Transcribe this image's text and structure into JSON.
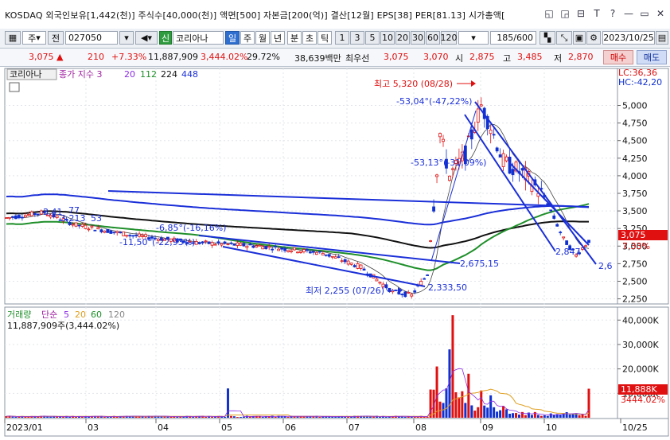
{
  "title_bar": {
    "text": "KOSDAQ 외국인보유[1,442(천)] 주식수[40,000(천)] 액면[500] 자본금[200(억)] 결산[12월] EPS[38] PER[81.13] 시가총액[",
    "buttons": [
      "◱",
      "◲",
      "⊟",
      "T",
      "?",
      "—",
      "▭",
      "✕"
    ]
  },
  "toolbar": {
    "mode_day": "주",
    "mode_all": "전",
    "stock_code": "027050",
    "stock_tag": "신",
    "stock_name": "코리아나",
    "periods": [
      "일",
      "주",
      "월",
      "년",
      "분",
      "초",
      "틱"
    ],
    "active_period": "일",
    "intervals": [
      "1",
      "3",
      "5",
      "10",
      "20",
      "30",
      "60",
      "120"
    ],
    "count": "185",
    "max_count": "/600",
    "date": "2023/10/25"
  },
  "quote": {
    "price": "3,075",
    "arrow": "▲",
    "change": "210",
    "change_pct": "+7.33%",
    "volume": "11,887,909",
    "volume_pct": "3,444.02%",
    "turnover": "29.72%",
    "amount": "38,639백만",
    "priority_label": "최우선",
    "ask": "3,075",
    "bid": "3,070",
    "open_label": "시",
    "open": "2,875",
    "high_label": "고",
    "high": "3,485",
    "low_label": "저",
    "low": "2,870",
    "buy": "매수",
    "sell": "매도"
  },
  "price_panel": {
    "stock_label": "코리아나",
    "indicator_label": "종가 지수 3",
    "ma_values": [
      "20",
      "112",
      "224",
      "448"
    ],
    "lc": "LC:36,36",
    "hc": "HC:-42,20",
    "y_ticks": [
      "5,000",
      "4,750",
      "4,500",
      "4,250",
      "4,000",
      "3,750",
      "3,500",
      "3,250",
      "3,000",
      "2,750",
      "2,500",
      "2,250"
    ],
    "current_price": "3,075",
    "current_pct": "7.33%",
    "annotations": {
      "high": "최고 5,320 (08/28)",
      "low": "최저 2,255 (07/26)",
      "t1": "-53,04°(-47,22%)",
      "t2": "-53,13°(-31,09%)",
      "t3": "-6,85°(-16,16%)",
      "t4": "-11,50°(-22,93%)",
      "l1": "2,675,15",
      "l2": "2,333,50",
      "l3": "2,847",
      "l4": "2,6",
      "l5": "3,41",
      "l6": "3,213",
      "l7": "77",
      "l8": "53"
    }
  },
  "volume_panel": {
    "label": "거래량",
    "type": "단순",
    "ma_values": [
      "5",
      "20",
      "60",
      "120"
    ],
    "volume_text": "11,887,909주(3,444.02%)",
    "y_ticks": [
      "40,000K",
      "30,000K",
      "20,000K",
      "10,000K"
    ],
    "current_vol": "11,888K",
    "current_pct": "3444.02%"
  },
  "x_axis": {
    "labels": [
      "2023/01",
      "03",
      "04",
      "05",
      "06",
      "07",
      "08",
      "09",
      "10",
      "10/25"
    ]
  },
  "colors": {
    "up": "#e01010",
    "down": "#1030d0",
    "ma20": "#8a2be2",
    "ma112": "#1f8f2a",
    "ma224": "#111111",
    "ma448": "#1a2fd8",
    "vol_ma20": "#e0a020",
    "vol_ma60": "#1f8f2a"
  }
}
